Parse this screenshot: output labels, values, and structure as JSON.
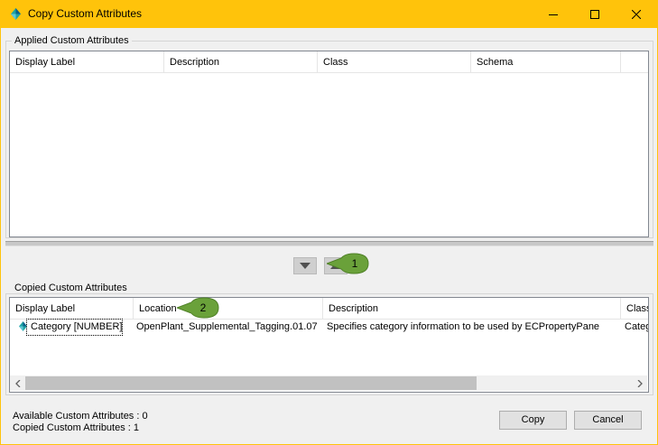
{
  "window": {
    "title": "Copy Custom Attributes",
    "icons": {
      "app": "bentley-diamond-icon",
      "minimize": "minimize-icon",
      "maximize": "maximize-icon",
      "close": "close-icon"
    },
    "accent_color": "#ffc30b"
  },
  "applied": {
    "group_label": "Applied Custom Attributes",
    "columns": [
      "Display Label",
      "Description",
      "Class",
      "Schema"
    ],
    "rows": []
  },
  "move_buttons": {
    "down_icon": "triangle-down-icon",
    "up_icon": "triangle-up-icon"
  },
  "callouts": [
    "1",
    "2"
  ],
  "copied": {
    "group_label": "Copied Custom Attributes",
    "columns": [
      "Display Label",
      "Location",
      "Description",
      "Class"
    ],
    "rows": [
      {
        "display_label": "Category [NUMBER]",
        "location": "OpenPlant_Supplemental_Tagging.01.07",
        "description": "Specifies category information to be used by ECPropertyPane",
        "class": "Categ"
      }
    ]
  },
  "status": {
    "available": "Available Custom Attributes : 0",
    "copied": "Copied Custom Attributes : 1"
  },
  "buttons": {
    "copy": "Copy",
    "cancel": "Cancel"
  }
}
